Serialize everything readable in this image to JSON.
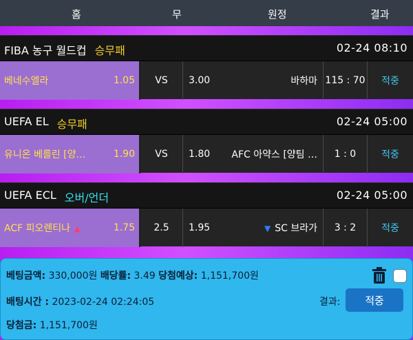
{
  "header": {
    "home": "홈",
    "draw": "무",
    "away": "원정",
    "result": "결과"
  },
  "games": [
    {
      "league": "FIBA 농구 월드컵",
      "market": "승무패",
      "datetime": "02-24 08:10",
      "home_team": "베네수엘라",
      "home_odd": "1.05",
      "middle": "VS",
      "away_odd": "3.00",
      "away_team": "바하마",
      "score": "115 : 70",
      "result": "적중"
    },
    {
      "league": "UEFA EL",
      "market": "승무패",
      "datetime": "02-24 05:00",
      "home_team": "유니온 베를린 [양…",
      "home_odd": "1.90",
      "middle": "VS",
      "away_odd": "1.80",
      "away_team": "AFC 아약스 [양팀 …",
      "score": "1 : 0",
      "result": "적중"
    },
    {
      "league": "UEFA ECL",
      "market": "오버/언더",
      "datetime": "02-24 05:00",
      "home_team": "ACF 피오렌티나",
      "home_odd": "1.75",
      "middle": "2.5",
      "away_odd": "1.95",
      "away_team": "SC 브라가",
      "score": "3 : 2",
      "result": "적중"
    }
  ],
  "summary": {
    "bet_amount_label": "베팅금액:",
    "bet_amount": "330,000원",
    "odds_label": "배당률:",
    "odds": "3.49",
    "expected_label": "당첨예상:",
    "expected": "1,151,700원",
    "bet_time_label": "배팅시간 :",
    "bet_time": "2023-02-24 02:24:05",
    "result_label": "결과:",
    "result_button": "적중",
    "win_label": "당첨금:",
    "win_amount": "1,151,700원"
  },
  "icons": {
    "over": "triangle-up-icon",
    "under": "triangle-down-icon",
    "delete": "trash-icon"
  },
  "colors": {
    "accent_yellow": "#f1cc2c",
    "accent_cyan": "#35e0ee",
    "result_blue": "#40c7ee",
    "summary_bg": "#2fb7ee"
  }
}
